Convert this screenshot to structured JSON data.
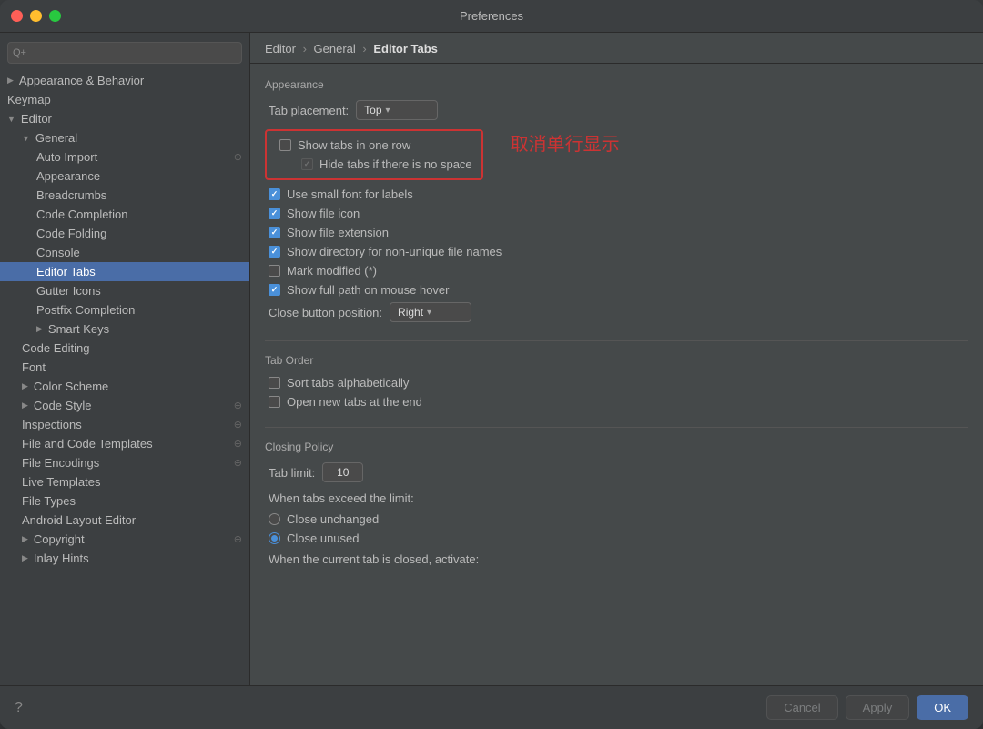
{
  "window": {
    "title": "Preferences"
  },
  "sidebar": {
    "search_placeholder": "Q+",
    "items": [
      {
        "id": "appearance-behavior",
        "label": "Appearance & Behavior",
        "level": 0,
        "chevron": "▶",
        "indent": 0
      },
      {
        "id": "keymap",
        "label": "Keymap",
        "level": 0,
        "indent": 0
      },
      {
        "id": "editor",
        "label": "Editor",
        "level": 0,
        "chevron": "▼",
        "indent": 0,
        "expanded": true
      },
      {
        "id": "general",
        "label": "General",
        "level": 1,
        "chevron": "▼",
        "indent": 1,
        "expanded": true
      },
      {
        "id": "auto-import",
        "label": "Auto Import",
        "level": 2,
        "indent": 2,
        "hasIcon": true
      },
      {
        "id": "appearance",
        "label": "Appearance",
        "level": 2,
        "indent": 2
      },
      {
        "id": "breadcrumbs",
        "label": "Breadcrumbs",
        "level": 2,
        "indent": 2
      },
      {
        "id": "code-completion",
        "label": "Code Completion",
        "level": 2,
        "indent": 2
      },
      {
        "id": "code-folding",
        "label": "Code Folding",
        "level": 2,
        "indent": 2
      },
      {
        "id": "console",
        "label": "Console",
        "level": 2,
        "indent": 2
      },
      {
        "id": "editor-tabs",
        "label": "Editor Tabs",
        "level": 2,
        "indent": 2,
        "active": true
      },
      {
        "id": "gutter-icons",
        "label": "Gutter Icons",
        "level": 2,
        "indent": 2
      },
      {
        "id": "postfix-completion",
        "label": "Postfix Completion",
        "level": 2,
        "indent": 2
      },
      {
        "id": "smart-keys",
        "label": "Smart Keys",
        "level": 2,
        "indent": 2,
        "chevron": "▶"
      },
      {
        "id": "code-editing",
        "label": "Code Editing",
        "level": 1,
        "indent": 1
      },
      {
        "id": "font",
        "label": "Font",
        "level": 1,
        "indent": 1
      },
      {
        "id": "color-scheme",
        "label": "Color Scheme",
        "level": 1,
        "indent": 1,
        "chevron": "▶"
      },
      {
        "id": "code-style",
        "label": "Code Style",
        "level": 1,
        "indent": 1,
        "chevron": "▶",
        "hasIcon": true
      },
      {
        "id": "inspections",
        "label": "Inspections",
        "level": 1,
        "indent": 1,
        "hasIcon": true
      },
      {
        "id": "file-code-templates",
        "label": "File and Code Templates",
        "level": 1,
        "indent": 1,
        "hasIcon": true
      },
      {
        "id": "file-encodings",
        "label": "File Encodings",
        "level": 1,
        "indent": 1,
        "hasIcon": true
      },
      {
        "id": "live-templates",
        "label": "Live Templates",
        "level": 1,
        "indent": 1
      },
      {
        "id": "file-types",
        "label": "File Types",
        "level": 1,
        "indent": 1
      },
      {
        "id": "android-layout-editor",
        "label": "Android Layout Editor",
        "level": 1,
        "indent": 1
      },
      {
        "id": "copyright",
        "label": "Copyright",
        "level": 1,
        "indent": 1,
        "chevron": "▶",
        "hasIcon": true
      },
      {
        "id": "inlay-hints",
        "label": "Inlay Hints",
        "level": 1,
        "indent": 1,
        "chevron": "▶"
      }
    ]
  },
  "breadcrumb": {
    "parts": [
      "Editor",
      "General",
      "Editor Tabs"
    ],
    "separators": [
      "›",
      "›"
    ]
  },
  "settings": {
    "appearance_section_title": "Appearance",
    "tab_placement_label": "Tab placement:",
    "tab_placement_value": "Top",
    "show_tabs_one_row_label": "Show tabs in one row",
    "show_tabs_one_row_checked": false,
    "hide_tabs_label": "Hide tabs if there is no space",
    "hide_tabs_checked": true,
    "hide_tabs_disabled": true,
    "chinese_annotation": "取消单行显示",
    "use_small_font_label": "Use small font for labels",
    "use_small_font_checked": true,
    "show_file_icon_label": "Show file icon",
    "show_file_icon_checked": true,
    "show_file_extension_label": "Show file extension",
    "show_file_extension_checked": true,
    "show_directory_label": "Show directory for non-unique file names",
    "show_directory_checked": true,
    "mark_modified_label": "Mark modified (*)",
    "mark_modified_checked": false,
    "show_full_path_label": "Show full path on mouse hover",
    "show_full_path_checked": true,
    "close_button_label": "Close button position:",
    "close_button_value": "Right",
    "tab_order_section_title": "Tab Order",
    "sort_tabs_label": "Sort tabs alphabetically",
    "sort_tabs_checked": false,
    "open_new_tabs_label": "Open new tabs at the end",
    "open_new_tabs_checked": false,
    "closing_policy_section_title": "Closing Policy",
    "tab_limit_label": "Tab limit:",
    "tab_limit_value": "10",
    "when_exceed_label": "When tabs exceed the limit:",
    "close_unchanged_label": "Close unchanged",
    "close_unchanged_selected": false,
    "close_unused_label": "Close unused",
    "close_unused_selected": true,
    "when_closed_label": "When the current tab is closed, activate:",
    "buttons": {
      "cancel": "Cancel",
      "apply": "Apply",
      "ok": "OK",
      "help": "?"
    }
  }
}
